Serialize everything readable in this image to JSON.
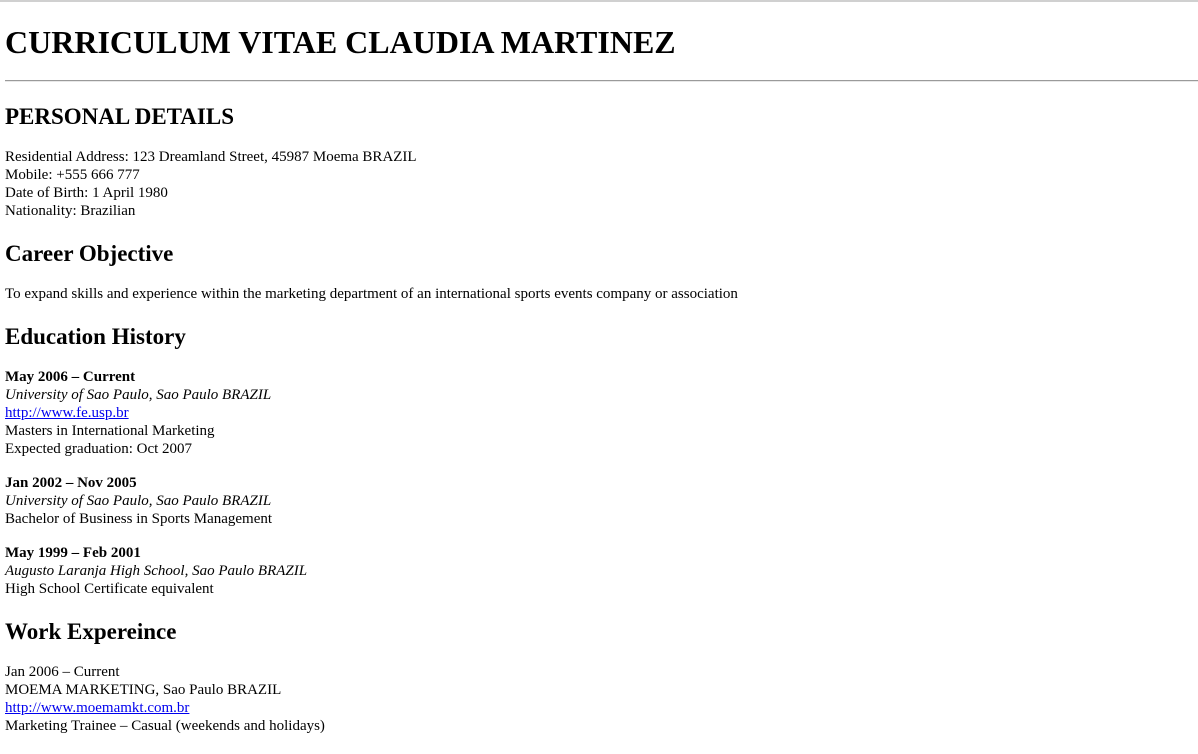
{
  "title": "CURRICULUM VITAE CLAUDIA MARTINEZ",
  "personal": {
    "heading": "PERSONAL DETAILS",
    "address": "Residential Address: 123 Dreamland Street, 45987 Moema BRAZIL",
    "mobile": "Mobile: +555 666 777",
    "dob": "Date of Birth: 1 April 1980",
    "nationality": "Nationality: Brazilian"
  },
  "career": {
    "heading": "Career Objective",
    "text": "To expand skills and experience within the marketing department of an international sports events company or association"
  },
  "education": {
    "heading": "Education History",
    "entries": [
      {
        "dates": "May 2006 – Current",
        "institution": "University of Sao Paulo, Sao Paulo BRAZIL",
        "url": "http://www.fe.usp.br",
        "degree": "Masters in International Marketing",
        "note": "Expected graduation: Oct 2007"
      },
      {
        "dates": "Jan 2002 – Nov 2005",
        "institution": "University of Sao Paulo, Sao Paulo BRAZIL",
        "degree": "Bachelor of Business in Sports Management"
      },
      {
        "dates": "May 1999 – Feb 2001",
        "institution": "Augusto Laranja High School, Sao Paulo BRAZIL",
        "degree": "High School Certificate equivalent"
      }
    ]
  },
  "work": {
    "heading": "Work Expereince",
    "entries": [
      {
        "dates": "Jan 2006 – Current",
        "employer": "MOEMA MARKETING, Sao Paulo BRAZIL",
        "url": "http://www.moemamkt.com.br",
        "role": "Marketing Trainee – Casual (weekends and holidays)"
      }
    ]
  },
  "colors": {
    "link": "#0000ee",
    "text": "#000000",
    "background": "#ffffff"
  }
}
